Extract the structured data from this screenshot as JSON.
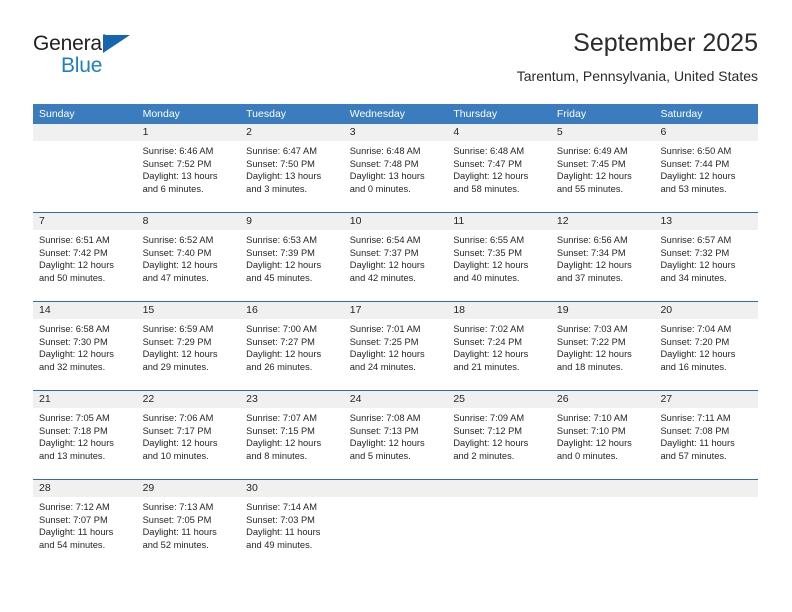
{
  "logo": {
    "word_one": "General",
    "word_two": "Blue",
    "accent_dark": "#1565b0",
    "accent_light": "#1e80c8"
  },
  "header": {
    "title": "September 2025",
    "subtitle": "Tarentum, Pennsylvania, United States"
  },
  "theme": {
    "header_blue": "#3a7cbe",
    "separator_blue": "#2f6daf",
    "daynum_band": "#f0f0f0"
  },
  "weekdays": [
    "Sunday",
    "Monday",
    "Tuesday",
    "Wednesday",
    "Thursday",
    "Friday",
    "Saturday"
  ],
  "weeks": [
    [
      {
        "day": "",
        "lines": []
      },
      {
        "day": "1",
        "lines": [
          "Sunrise: 6:46 AM",
          "Sunset: 7:52 PM",
          "Daylight: 13 hours",
          "and 6 minutes."
        ]
      },
      {
        "day": "2",
        "lines": [
          "Sunrise: 6:47 AM",
          "Sunset: 7:50 PM",
          "Daylight: 13 hours",
          "and 3 minutes."
        ]
      },
      {
        "day": "3",
        "lines": [
          "Sunrise: 6:48 AM",
          "Sunset: 7:48 PM",
          "Daylight: 13 hours",
          "and 0 minutes."
        ]
      },
      {
        "day": "4",
        "lines": [
          "Sunrise: 6:48 AM",
          "Sunset: 7:47 PM",
          "Daylight: 12 hours",
          "and 58 minutes."
        ]
      },
      {
        "day": "5",
        "lines": [
          "Sunrise: 6:49 AM",
          "Sunset: 7:45 PM",
          "Daylight: 12 hours",
          "and 55 minutes."
        ]
      },
      {
        "day": "6",
        "lines": [
          "Sunrise: 6:50 AM",
          "Sunset: 7:44 PM",
          "Daylight: 12 hours",
          "and 53 minutes."
        ]
      }
    ],
    [
      {
        "day": "7",
        "lines": [
          "Sunrise: 6:51 AM",
          "Sunset: 7:42 PM",
          "Daylight: 12 hours",
          "and 50 minutes."
        ]
      },
      {
        "day": "8",
        "lines": [
          "Sunrise: 6:52 AM",
          "Sunset: 7:40 PM",
          "Daylight: 12 hours",
          "and 47 minutes."
        ]
      },
      {
        "day": "9",
        "lines": [
          "Sunrise: 6:53 AM",
          "Sunset: 7:39 PM",
          "Daylight: 12 hours",
          "and 45 minutes."
        ]
      },
      {
        "day": "10",
        "lines": [
          "Sunrise: 6:54 AM",
          "Sunset: 7:37 PM",
          "Daylight: 12 hours",
          "and 42 minutes."
        ]
      },
      {
        "day": "11",
        "lines": [
          "Sunrise: 6:55 AM",
          "Sunset: 7:35 PM",
          "Daylight: 12 hours",
          "and 40 minutes."
        ]
      },
      {
        "day": "12",
        "lines": [
          "Sunrise: 6:56 AM",
          "Sunset: 7:34 PM",
          "Daylight: 12 hours",
          "and 37 minutes."
        ]
      },
      {
        "day": "13",
        "lines": [
          "Sunrise: 6:57 AM",
          "Sunset: 7:32 PM",
          "Daylight: 12 hours",
          "and 34 minutes."
        ]
      }
    ],
    [
      {
        "day": "14",
        "lines": [
          "Sunrise: 6:58 AM",
          "Sunset: 7:30 PM",
          "Daylight: 12 hours",
          "and 32 minutes."
        ]
      },
      {
        "day": "15",
        "lines": [
          "Sunrise: 6:59 AM",
          "Sunset: 7:29 PM",
          "Daylight: 12 hours",
          "and 29 minutes."
        ]
      },
      {
        "day": "16",
        "lines": [
          "Sunrise: 7:00 AM",
          "Sunset: 7:27 PM",
          "Daylight: 12 hours",
          "and 26 minutes."
        ]
      },
      {
        "day": "17",
        "lines": [
          "Sunrise: 7:01 AM",
          "Sunset: 7:25 PM",
          "Daylight: 12 hours",
          "and 24 minutes."
        ]
      },
      {
        "day": "18",
        "lines": [
          "Sunrise: 7:02 AM",
          "Sunset: 7:24 PM",
          "Daylight: 12 hours",
          "and 21 minutes."
        ]
      },
      {
        "day": "19",
        "lines": [
          "Sunrise: 7:03 AM",
          "Sunset: 7:22 PM",
          "Daylight: 12 hours",
          "and 18 minutes."
        ]
      },
      {
        "day": "20",
        "lines": [
          "Sunrise: 7:04 AM",
          "Sunset: 7:20 PM",
          "Daylight: 12 hours",
          "and 16 minutes."
        ]
      }
    ],
    [
      {
        "day": "21",
        "lines": [
          "Sunrise: 7:05 AM",
          "Sunset: 7:18 PM",
          "Daylight: 12 hours",
          "and 13 minutes."
        ]
      },
      {
        "day": "22",
        "lines": [
          "Sunrise: 7:06 AM",
          "Sunset: 7:17 PM",
          "Daylight: 12 hours",
          "and 10 minutes."
        ]
      },
      {
        "day": "23",
        "lines": [
          "Sunrise: 7:07 AM",
          "Sunset: 7:15 PM",
          "Daylight: 12 hours",
          "and 8 minutes."
        ]
      },
      {
        "day": "24",
        "lines": [
          "Sunrise: 7:08 AM",
          "Sunset: 7:13 PM",
          "Daylight: 12 hours",
          "and 5 minutes."
        ]
      },
      {
        "day": "25",
        "lines": [
          "Sunrise: 7:09 AM",
          "Sunset: 7:12 PM",
          "Daylight: 12 hours",
          "and 2 minutes."
        ]
      },
      {
        "day": "26",
        "lines": [
          "Sunrise: 7:10 AM",
          "Sunset: 7:10 PM",
          "Daylight: 12 hours",
          "and 0 minutes."
        ]
      },
      {
        "day": "27",
        "lines": [
          "Sunrise: 7:11 AM",
          "Sunset: 7:08 PM",
          "Daylight: 11 hours",
          "and 57 minutes."
        ]
      }
    ],
    [
      {
        "day": "28",
        "lines": [
          "Sunrise: 7:12 AM",
          "Sunset: 7:07 PM",
          "Daylight: 11 hours",
          "and 54 minutes."
        ]
      },
      {
        "day": "29",
        "lines": [
          "Sunrise: 7:13 AM",
          "Sunset: 7:05 PM",
          "Daylight: 11 hours",
          "and 52 minutes."
        ]
      },
      {
        "day": "30",
        "lines": [
          "Sunrise: 7:14 AM",
          "Sunset: 7:03 PM",
          "Daylight: 11 hours",
          "and 49 minutes."
        ]
      },
      {
        "day": "",
        "lines": []
      },
      {
        "day": "",
        "lines": []
      },
      {
        "day": "",
        "lines": []
      },
      {
        "day": "",
        "lines": []
      }
    ]
  ]
}
